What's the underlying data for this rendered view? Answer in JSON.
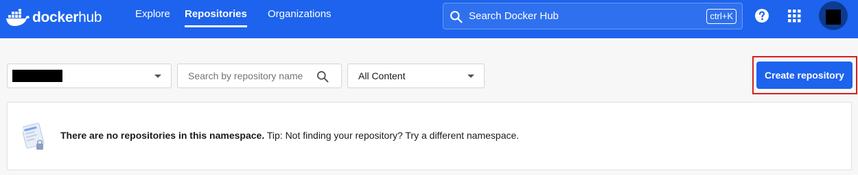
{
  "header": {
    "brand": {
      "bold": "docker",
      "light": "hub"
    },
    "nav": [
      {
        "label": "Explore",
        "active": false
      },
      {
        "label": "Repositories",
        "active": true
      },
      {
        "label": "Organizations",
        "active": false
      }
    ],
    "search": {
      "placeholder": "Search Docker Hub",
      "shortcut": "ctrl+K",
      "icon": "search-icon"
    },
    "icons": [
      "help-icon",
      "apps-grid-icon"
    ],
    "avatar": "avatar"
  },
  "filters": {
    "namespace": {
      "value": "",
      "icon": "chevron-down-icon"
    },
    "repo_search": {
      "placeholder": "Search by repository name",
      "value": "",
      "icon": "search-icon"
    },
    "content": {
      "value": "All Content",
      "icon": "chevron-down-icon"
    }
  },
  "actions": {
    "create_label": "Create repository"
  },
  "empty_state": {
    "title": "There are no repositories in this namespace.",
    "tip": "Tip: Not finding your repository? Try a different namespace.",
    "icon": "empty-repo-illustration"
  },
  "colors": {
    "brand_blue": "#1d63ed",
    "page_bg": "#f7f7f7",
    "highlight_outline": "#d32020"
  }
}
